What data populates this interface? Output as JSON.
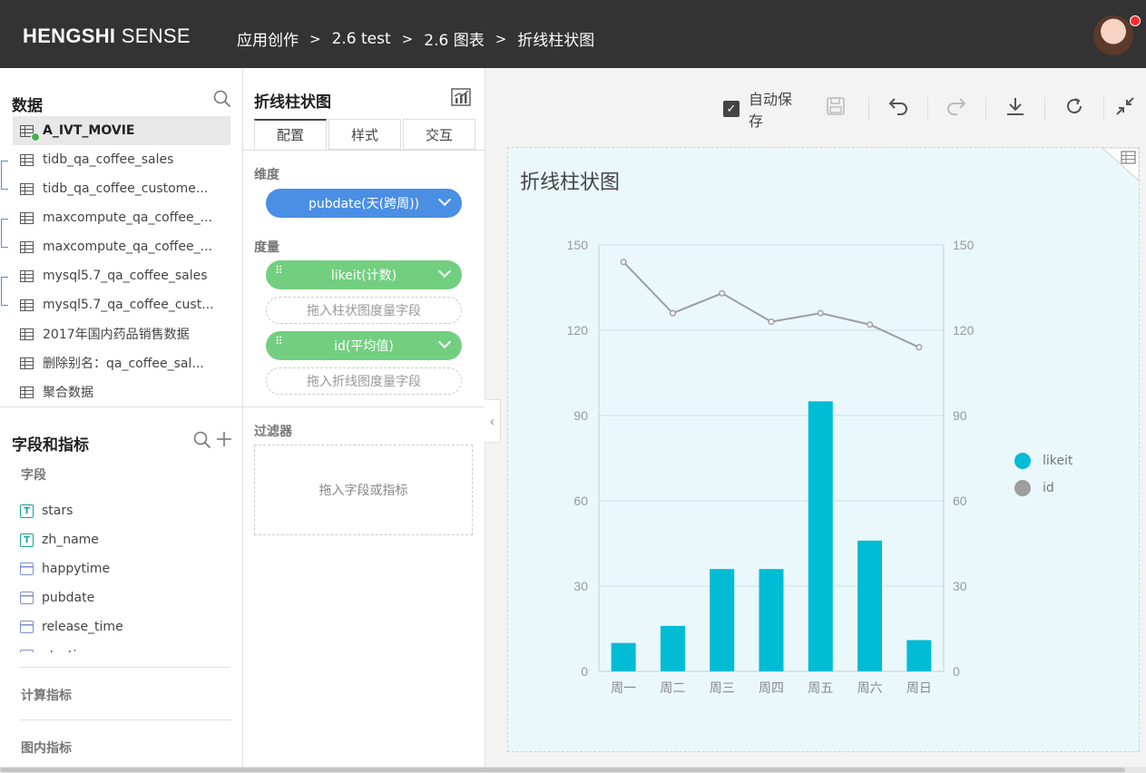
{
  "header": {
    "logo_bold": "HENGSHI",
    "logo_light": "SENSE",
    "breadcrumb": [
      "应用创作",
      "2.6 test",
      "2.6 图表",
      "折线柱状图"
    ],
    "separator": ">"
  },
  "data_panel": {
    "title": "数据",
    "datasets": [
      {
        "name": "A_IVT_MOVIE",
        "active": true
      },
      {
        "name": "tidb_qa_coffee_sales"
      },
      {
        "name": "tidb_qa_coffee_custome..."
      },
      {
        "name": "maxcompute_qa_coffee_..."
      },
      {
        "name": "maxcompute_qa_coffee_..."
      },
      {
        "name": "mysql5.7_qa_coffee_sales"
      },
      {
        "name": "mysql5.7_qa_coffee_cust..."
      },
      {
        "name": "2017年国内药品销售数据"
      },
      {
        "name": "删除别名：qa_coffee_sal..."
      },
      {
        "name": "聚合数据"
      }
    ]
  },
  "fields_panel": {
    "title": "字段和指标",
    "fields_label": "字段",
    "fields": [
      {
        "name": "stars",
        "type": "text"
      },
      {
        "name": "zh_name",
        "type": "text"
      },
      {
        "name": "happytime",
        "type": "date"
      },
      {
        "name": "pubdate",
        "type": "date"
      },
      {
        "name": "release_time",
        "type": "date"
      },
      {
        "name": "utc_time",
        "type": "date"
      }
    ],
    "calc_metrics_label": "计算指标",
    "chart_metrics_label": "图内指标"
  },
  "config_panel": {
    "title": "折线柱状图",
    "tabs": [
      "配置",
      "样式",
      "交互"
    ],
    "dimension_label": "维度",
    "dimension_pill": "pubdate(天(跨周))",
    "measure_label": "度量",
    "measure_pill_1": "likeit(计数)",
    "bar_drop": "拖入柱状图度量字段",
    "measure_pill_2": "id(平均值)",
    "line_drop": "拖入折线图度量字段",
    "filter_label": "过滤器",
    "filter_drop": "拖入字段或指标"
  },
  "toolbar": {
    "autosave_label": "自动保存",
    "autosave_checked": true
  },
  "chart_data": {
    "type": "bar",
    "title": "折线柱状图",
    "categories": [
      "周一",
      "周二",
      "周三",
      "周四",
      "周五",
      "周六",
      "周日"
    ],
    "series": [
      {
        "name": "likeit",
        "type": "bar",
        "color": "#00bcd4",
        "values": [
          10,
          16,
          36,
          36,
          95,
          46,
          11
        ]
      },
      {
        "name": "id",
        "type": "line",
        "color": "#9e9e9e",
        "values": [
          144,
          126,
          133,
          123,
          126,
          122,
          114
        ]
      }
    ],
    "ylim": [
      0,
      150
    ],
    "yticks": [
      0,
      30,
      60,
      90,
      120,
      150
    ],
    "y2ticks": [
      0,
      30,
      60,
      90,
      120,
      150
    ],
    "grid": true,
    "legend": "right"
  }
}
